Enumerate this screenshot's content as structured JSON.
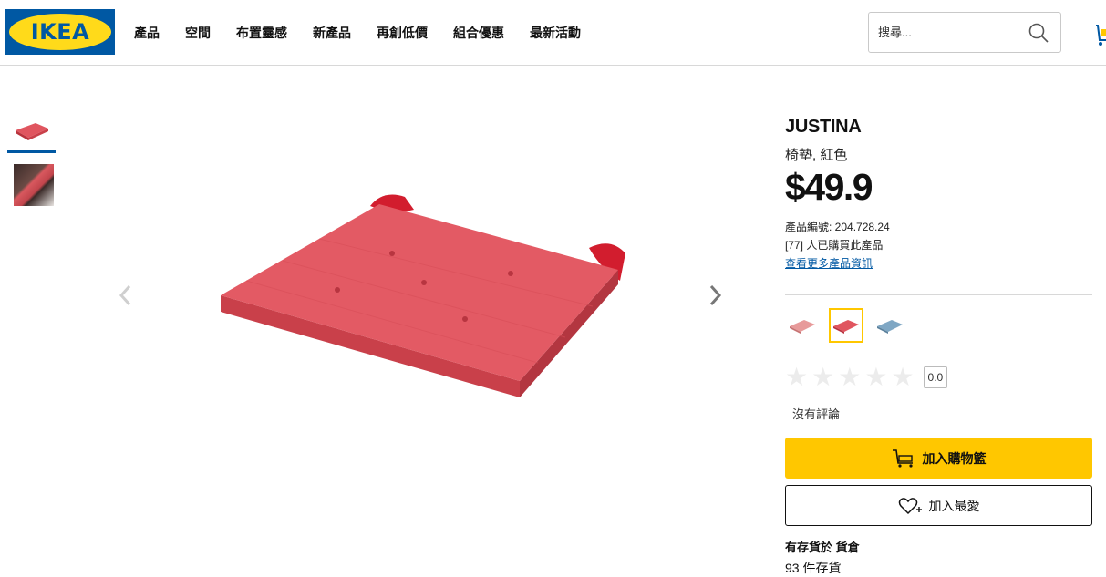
{
  "header": {
    "logo_text": "IKEA",
    "nav": [
      "產品",
      "空間",
      "布置靈感",
      "新產品",
      "再創低價",
      "組合優惠",
      "最新活動"
    ],
    "search_placeholder": "搜尋..."
  },
  "product": {
    "name": "JUSTINA",
    "description": "椅墊, 紅色",
    "price": "$49.9",
    "product_number_label": "產品編號: 204.728.24",
    "purchased_text": "[77] 人已購買此產品",
    "more_info_link": "查看更多產品資訊",
    "rating_score": "0.0",
    "no_reviews": "沒有評論",
    "add_to_cart": "加入購物籃",
    "add_to_favorites": "加入最愛",
    "stock_title": "有存貨於 貨倉",
    "stock_count": "93 件存貨"
  },
  "colors": {
    "brand_blue": "#0058a3",
    "brand_yellow": "#ffc700",
    "cushion_red": "#e0555f"
  }
}
